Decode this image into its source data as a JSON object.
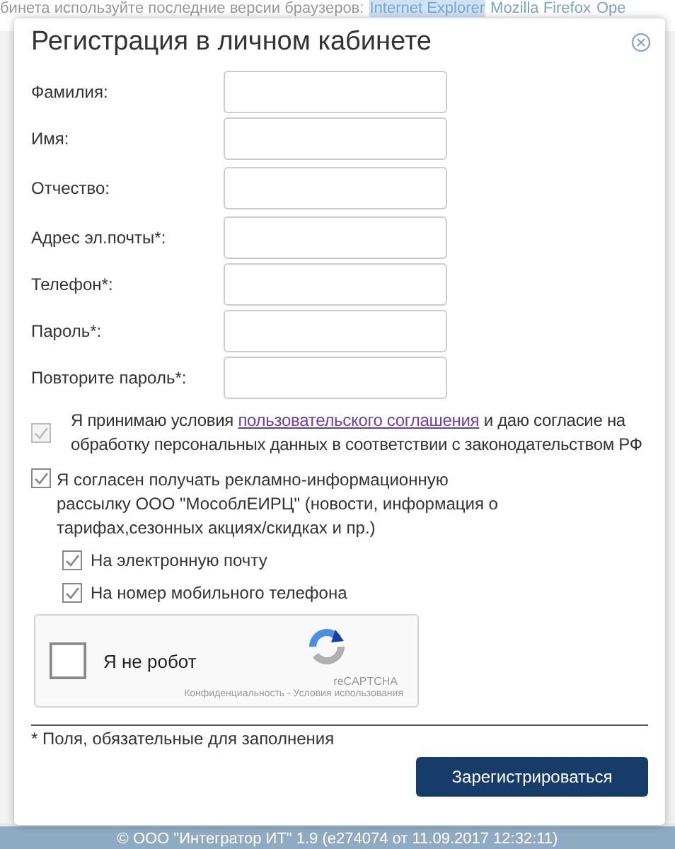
{
  "page": {
    "notice": "бинета используйте последние версии браузеров:",
    "browser_links": [
      {
        "label": "Internet Explorer",
        "selected": true
      },
      {
        "label": "Mozilla Firefox",
        "selected": false
      },
      {
        "label": "Ope",
        "selected": false
      }
    ],
    "footer": "© ООО \"Интегратор ИТ\" 1.9 (e274074 от 11.09.2017 12:32:11)"
  },
  "dialog": {
    "title": "Регистрация в личном кабинете",
    "fields": [
      {
        "label": "Фамилия:"
      },
      {
        "label": "Имя:"
      },
      {
        "label": "Отчество:"
      },
      {
        "label": "Адрес эл.почты*:"
      },
      {
        "label": "Телефон*:"
      },
      {
        "label": "Пароль*:"
      },
      {
        "label": "Повторите пароль*:"
      }
    ],
    "agreement": {
      "text_before": "Я принимаю условия",
      "link": "пользовательского соглашения",
      "text_after": "и даю согласие на обработку персональных данных в соответствии с законодательством РФ",
      "checked": true,
      "disabled": true
    },
    "mailing": {
      "text": "Я согласен получать рекламно-информационную рассылку ООО \"МособлЕИРЦ\" (новости, информация о тарифах,сезонных акциях/скидках и пр.)",
      "checked": true,
      "children": [
        {
          "label": "На электронную почту",
          "checked": true
        },
        {
          "label": "На номер мобильного телефона",
          "checked": true
        }
      ]
    },
    "captcha": {
      "label": "Я не робот",
      "checked": false,
      "brand": "reCAPTCHA",
      "terms": "Конфиденциальность - Условия использования"
    },
    "footnote": "* Поля, обязательные для заполнения",
    "submit_button": "Зарегистрироваться"
  }
}
